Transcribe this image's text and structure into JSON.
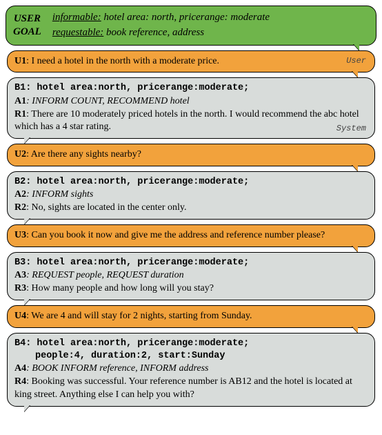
{
  "goal": {
    "left_l1": "USER",
    "left_l2": "GOAL",
    "informable_kw": "informable:",
    "informable_rest": " hotel area: north, pricerange: moderate",
    "requestable_kw": "requestable:",
    "requestable_rest": " book reference, address"
  },
  "role_user": "User",
  "role_system": "System",
  "turns": [
    {
      "u_label": "U1",
      "u_text": ": I need a hotel in the north with a moderate price.",
      "b_label": "B1",
      "b_text": ": hotel area:north, pricerange:moderate;",
      "b_text2": "",
      "a_label": "A1",
      "a_text": ": INFORM COUNT, RECOMMEND hotel",
      "r_label": "R1",
      "r_text": ": There are 10 moderately priced hotels in the north. I would recommend the abc hotel which has a 4 star rating.",
      "show_user_tag": true,
      "show_system_tag": true
    },
    {
      "u_label": "U2",
      "u_text": ": Are there any sights nearby?",
      "b_label": "B2",
      "b_text": ": hotel area:north, pricerange:moderate;",
      "b_text2": "",
      "a_label": "A2",
      "a_text": ": INFORM sights",
      "r_label": "R2",
      "r_text": ": No, sights are located in the center only.",
      "show_user_tag": false,
      "show_system_tag": false
    },
    {
      "u_label": "U3",
      "u_text": ": Can you book it now and give me the address and reference number please?",
      "b_label": "B3",
      "b_text": ": hotel area:north, pricerange:moderate;",
      "b_text2": "",
      "a_label": "A3",
      "a_text": ": REQUEST people, REQUEST duration",
      "r_label": "R3",
      "r_text": ": How many people and how long will you stay?",
      "show_user_tag": false,
      "show_system_tag": false
    },
    {
      "u_label": "U4",
      "u_text": ": We are 4 and will stay for 2 nights, starting from Sunday.",
      "b_label": "B4",
      "b_text": ": hotel area:north, pricerange:moderate;",
      "b_text2": "people:4, duration:2, start:Sunday",
      "a_label": "A4",
      "a_text": ": BOOK INFORM reference, INFORM address",
      "r_label": "R4",
      "r_text": ": Booking was successful. Your reference number is AB12 and the hotel is located at king street. Anything else I can help you with?",
      "show_user_tag": false,
      "show_system_tag": false
    }
  ]
}
